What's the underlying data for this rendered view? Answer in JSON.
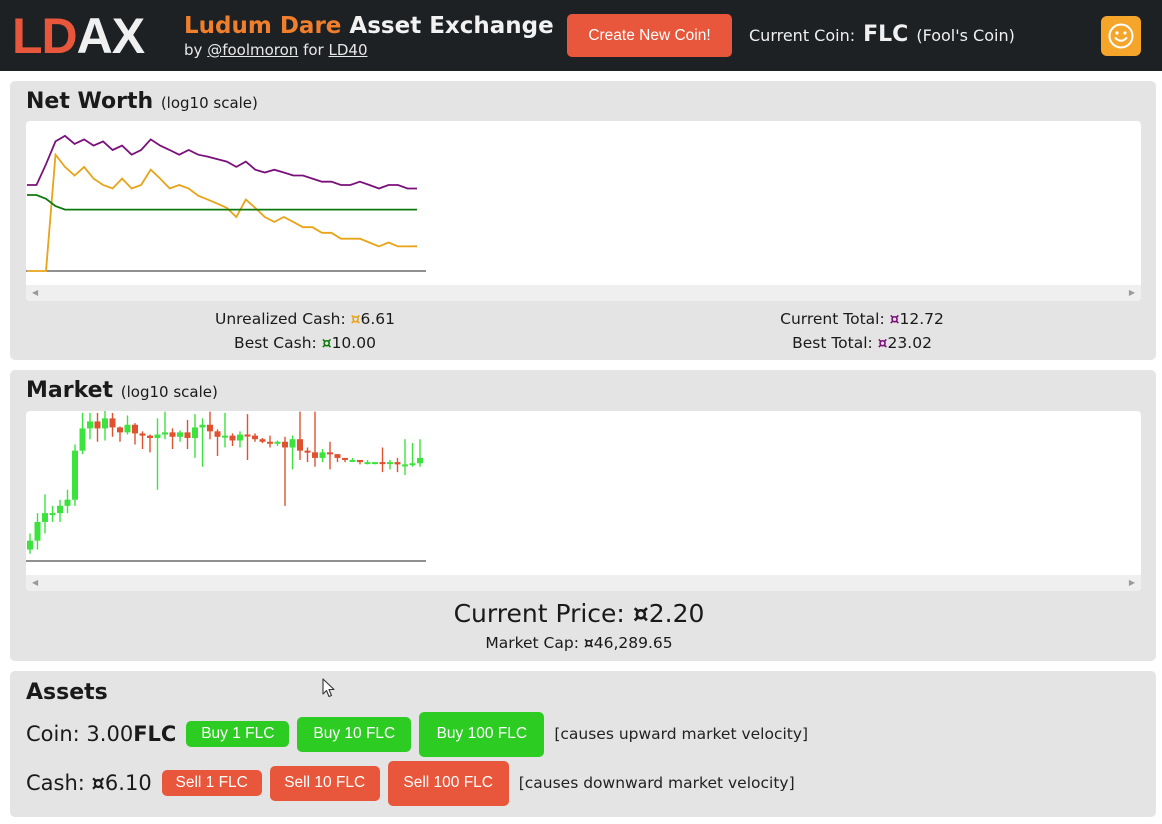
{
  "header": {
    "logo_part1": "LD",
    "logo_part2": "AX",
    "title_part1": "Ludum Dare",
    "title_part2": "Asset Exchange",
    "by_text": "by",
    "author_link": "@foolmoron",
    "for_text": "for",
    "event_link": "LD40",
    "create_button": "Create New Coin!",
    "current_coin_label": "Current Coin:",
    "current_coin_symbol": "FLC",
    "current_coin_name": "(Fool's Coin)"
  },
  "net_worth": {
    "title": "Net Worth",
    "scale_note": "(log10 scale)",
    "unrealized_label": "Unrealized Cash:",
    "unrealized_value": "6.61",
    "best_cash_label": "Best Cash:",
    "best_cash_value": "10.00",
    "current_total_label": "Current Total:",
    "current_total_value": "12.72",
    "best_total_label": "Best Total:",
    "best_total_value": "23.02",
    "currency_symbol": "¤"
  },
  "market": {
    "title": "Market",
    "scale_note": "(log10 scale)",
    "current_price_label": "Current Price:",
    "current_price_value": "2.20",
    "market_cap_label": "Market Cap:",
    "market_cap_value": "46,289.65"
  },
  "assets": {
    "title": "Assets",
    "coin_label": "Coin:",
    "coin_amount": "3.00",
    "coin_symbol": "FLC",
    "buy_buttons": [
      "Buy 1 FLC",
      "Buy 10 FLC",
      "Buy 100 FLC"
    ],
    "buy_note": "[causes upward market velocity]",
    "cash_label": "Cash:",
    "cash_amount": "6.10",
    "sell_buttons": [
      "Sell 1 FLC",
      "Sell 10 FLC",
      "Sell 100 FLC"
    ],
    "sell_note": "[causes downward market velocity]"
  },
  "colors": {
    "header_bg": "#1e2124",
    "accent_orange": "#f07f2d",
    "create_red": "#e8573b",
    "buy_green": "#2ccc22",
    "sell_red": "#e8573b",
    "unrealized_color": "#e8a317",
    "best_cash_color": "#0e7a0e",
    "total_color": "#7a117a",
    "smiley_bg": "#f4a52a"
  },
  "icons": {
    "smiley": "smiley-face-icon",
    "cursor": "mouse-pointer-icon",
    "scroll_left": "scroll-left-arrow-icon",
    "scroll_right": "scroll-right-arrow-icon"
  },
  "chart_data": [
    {
      "type": "line",
      "xlabel": "",
      "ylabel": "",
      "log_scale": true,
      "series": [
        {
          "color": "#7a117a",
          "values": [
            13.2,
            13.2,
            16.7,
            21.6,
            23.0,
            21.0,
            22.1,
            20.6,
            21.6,
            19.6,
            20.6,
            18.6,
            19.6,
            22.1,
            20.6,
            19.6,
            18.6,
            19.6,
            18.6,
            18.2,
            17.7,
            17.2,
            16.2,
            17.2,
            15.7,
            15.2,
            15.7,
            15.2,
            14.7,
            14.7,
            14.2,
            13.7,
            13.7,
            13.2,
            13.2,
            13.7,
            13.2,
            12.7,
            13.2,
            13.2,
            12.7,
            12.7
          ]
        },
        {
          "color": "#e8a317",
          "values": [
            0,
            0,
            5.0,
            18.6,
            16.2,
            14.7,
            16.2,
            14.2,
            13.2,
            12.7,
            14.2,
            12.7,
            13.2,
            15.7,
            14.2,
            12.7,
            13.2,
            12.7,
            11.7,
            11.2,
            10.7,
            10.2,
            9.2,
            11.2,
            10.2,
            9.2,
            8.7,
            9.2,
            8.7,
            8.2,
            8.2,
            7.7,
            7.7,
            7.2,
            7.2,
            7.2,
            6.9,
            6.6,
            6.9,
            6.6,
            6.6,
            6.61
          ]
        },
        {
          "color": "#0e7a0e",
          "values": [
            11.8,
            11.8,
            11.3,
            10.4,
            10.0,
            10.0,
            10.0,
            10.0,
            10.0,
            10.0,
            10.0,
            10.0,
            10.0,
            10.0,
            10.0,
            10.0,
            10.0,
            10.0,
            10.0,
            10.0,
            10.0,
            10.0,
            10.0,
            10.0,
            10.0,
            10.0,
            10.0,
            10.0,
            10.0,
            10.0,
            10.0,
            10.0,
            10.0,
            10.0,
            10.0,
            10.0,
            10.0,
            10.0,
            10.0,
            10.0,
            10.0,
            10.0
          ]
        }
      ]
    },
    {
      "type": "candlestick",
      "xlabel": "",
      "ylabel": "",
      "log_scale": true,
      "candles": [
        {
          "o": 0.2,
          "c": 0.25,
          "h": 0.3,
          "l": 0.18
        },
        {
          "o": 0.25,
          "c": 0.4,
          "h": 0.5,
          "l": 0.2
        },
        {
          "o": 0.4,
          "c": 0.5,
          "h": 0.8,
          "l": 0.3
        },
        {
          "o": 0.5,
          "c": 0.5,
          "h": 0.6,
          "l": 0.4
        },
        {
          "o": 0.5,
          "c": 0.6,
          "h": 0.7,
          "l": 0.4
        },
        {
          "o": 0.6,
          "c": 0.7,
          "h": 0.9,
          "l": 0.5
        },
        {
          "o": 0.7,
          "c": 2.4,
          "h": 2.8,
          "l": 0.6
        },
        {
          "o": 2.4,
          "c": 4.2,
          "h": 6.2,
          "l": 2.2
        },
        {
          "o": 4.2,
          "c": 5.0,
          "h": 6.2,
          "l": 3.2
        },
        {
          "o": 5.0,
          "c": 4.2,
          "h": 6.2,
          "l": 3.0
        },
        {
          "o": 4.2,
          "c": 5.4,
          "h": 7.0,
          "l": 3.1
        },
        {
          "o": 5.4,
          "c": 4.3,
          "h": 6.2,
          "l": 3.4
        },
        {
          "o": 4.3,
          "c": 3.8,
          "h": 4.4,
          "l": 3.0
        },
        {
          "o": 3.8,
          "c": 4.6,
          "h": 5.8,
          "l": 3.6
        },
        {
          "o": 4.6,
          "c": 3.7,
          "h": 4.8,
          "l": 2.8
        },
        {
          "o": 3.7,
          "c": 3.5,
          "h": 3.9,
          "l": 2.5
        },
        {
          "o": 3.5,
          "c": 3.3,
          "h": 3.6,
          "l": 2.3
        },
        {
          "o": 3.3,
          "c": 3.6,
          "h": 5.4,
          "l": 0.9
        },
        {
          "o": 3.6,
          "c": 3.8,
          "h": 6.4,
          "l": 3.2
        },
        {
          "o": 3.8,
          "c": 3.4,
          "h": 4.2,
          "l": 2.5
        },
        {
          "o": 3.4,
          "c": 3.8,
          "h": 4.0,
          "l": 3.0
        },
        {
          "o": 3.8,
          "c": 3.3,
          "h": 5.2,
          "l": 2.5
        },
        {
          "o": 3.3,
          "c": 4.3,
          "h": 6.0,
          "l": 2.0
        },
        {
          "o": 4.3,
          "c": 4.6,
          "h": 5.4,
          "l": 1.6
        },
        {
          "o": 4.6,
          "c": 3.9,
          "h": 6.4,
          "l": 3.2
        },
        {
          "o": 3.9,
          "c": 3.4,
          "h": 4.1,
          "l": 2.1
        },
        {
          "o": 3.4,
          "c": 3.5,
          "h": 6.2,
          "l": 2.6
        },
        {
          "o": 3.5,
          "c": 3.1,
          "h": 3.7,
          "l": 2.7
        },
        {
          "o": 3.1,
          "c": 3.6,
          "h": 3.9,
          "l": 2.6
        },
        {
          "o": 3.6,
          "c": 3.5,
          "h": 6.0,
          "l": 1.9
        },
        {
          "o": 3.5,
          "c": 3.2,
          "h": 3.7,
          "l": 3.0
        },
        {
          "o": 3.2,
          "c": 3.0,
          "h": 3.3,
          "l": 2.9
        },
        {
          "o": 3.0,
          "c": 2.9,
          "h": 3.5,
          "l": 2.6
        },
        {
          "o": 2.9,
          "c": 3.0,
          "h": 3.1,
          "l": 2.7
        },
        {
          "o": 3.0,
          "c": 2.6,
          "h": 3.4,
          "l": 0.6
        },
        {
          "o": 2.6,
          "c": 3.2,
          "h": 3.5,
          "l": 1.5
        },
        {
          "o": 3.2,
          "c": 2.4,
          "h": 6.4,
          "l": 1.9
        },
        {
          "o": 2.4,
          "c": 2.3,
          "h": 2.6,
          "l": 1.8
        },
        {
          "o": 2.3,
          "c": 2.0,
          "h": 6.4,
          "l": 1.6
        },
        {
          "o": 2.0,
          "c": 2.3,
          "h": 2.5,
          "l": 1.8
        },
        {
          "o": 2.3,
          "c": 2.2,
          "h": 3.0,
          "l": 1.5
        },
        {
          "o": 2.2,
          "c": 2.0,
          "h": 2.2,
          "l": 1.8
        },
        {
          "o": 2.0,
          "c": 1.9,
          "h": 2.0,
          "l": 1.8
        },
        {
          "o": 1.9,
          "c": 1.9,
          "h": 2.0,
          "l": 1.8
        },
        {
          "o": 1.9,
          "c": 1.8,
          "h": 1.9,
          "l": 1.7
        },
        {
          "o": 1.8,
          "c": 1.8,
          "h": 1.9,
          "l": 1.7
        },
        {
          "o": 1.8,
          "c": 1.8,
          "h": 1.8,
          "l": 1.7
        },
        {
          "o": 1.8,
          "c": 1.75,
          "h": 2.6,
          "l": 1.4
        },
        {
          "o": 1.75,
          "c": 1.8,
          "h": 1.9,
          "l": 1.5
        },
        {
          "o": 1.8,
          "c": 1.7,
          "h": 2.0,
          "l": 1.4
        },
        {
          "o": 1.7,
          "c": 1.7,
          "h": 3.2,
          "l": 1.3
        },
        {
          "o": 1.7,
          "c": 1.75,
          "h": 2.9,
          "l": 1.6
        },
        {
          "o": 1.75,
          "c": 2.0,
          "h": 3.2,
          "l": 1.6
        }
      ]
    }
  ]
}
